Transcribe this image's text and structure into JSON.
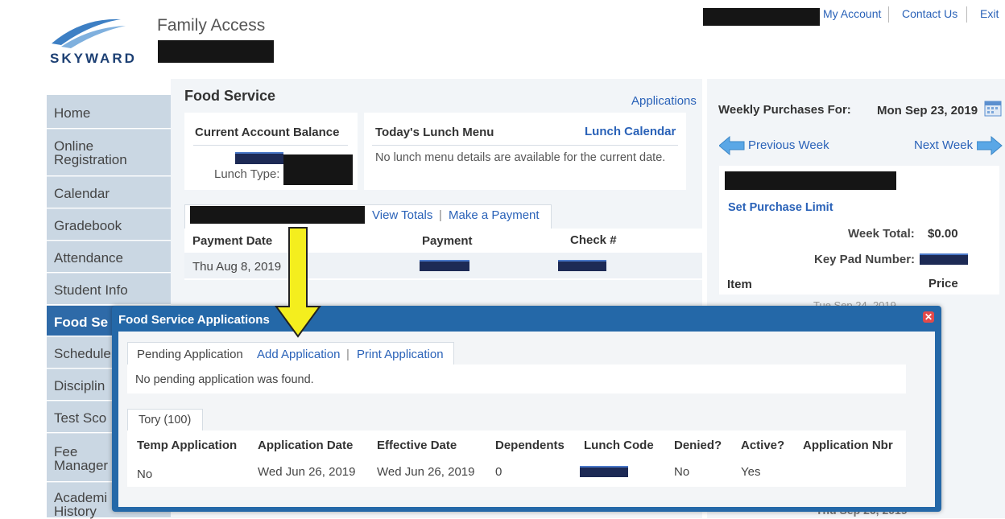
{
  "header": {
    "brand_text": "SKYWARD",
    "app_title": "Family Access",
    "links": {
      "my_account": "My Account",
      "contact_us": "Contact Us",
      "exit": "Exit"
    }
  },
  "sidebar": {
    "items": [
      {
        "label": "Home"
      },
      {
        "label": "Online Registration"
      },
      {
        "label": "Calendar"
      },
      {
        "label": "Gradebook"
      },
      {
        "label": "Attendance"
      },
      {
        "label": "Student Info"
      },
      {
        "label": "Food Se"
      },
      {
        "label": "Schedule"
      },
      {
        "label": "Disciplin"
      },
      {
        "label": "Test Sco"
      },
      {
        "label": "Fee Manager"
      },
      {
        "label": "Academi History"
      }
    ]
  },
  "food_service": {
    "title": "Food Service",
    "applications_link": "Applications",
    "balance_header": "Current Account Balance",
    "lunch_type_label": "Lunch Type:",
    "menu_header": "Today's Lunch Menu",
    "lunch_calendar_link": "Lunch Calendar",
    "menu_message": "No lunch menu details are available for the current date.",
    "view_totals": "View Totals",
    "make_payment": "Make a Payment",
    "link_sep": "|",
    "payments": {
      "columns": [
        "Payment Date",
        "Payment",
        "Check #"
      ],
      "rows": [
        {
          "date": "Thu Aug 8, 2019"
        }
      ]
    }
  },
  "weekly": {
    "label": "Weekly Purchases For:",
    "date": "Mon Sep 23, 2019",
    "previous_week": "Previous Week",
    "next_week": "Next Week",
    "set_limit": "Set Purchase Limit",
    "week_total_label": "Week Total:",
    "week_total_value": "$0.00",
    "key_pad_label": "Key Pad Number:",
    "col_item": "Item",
    "col_price": "Price",
    "bottom_date": "Thu Sep 26, 2019",
    "behind_date": "Tue Sep 24, 2019"
  },
  "modal": {
    "title": "Food Service Applications",
    "tab_pending": "Pending Application",
    "add_application": "Add Application",
    "print_application": "Print Application",
    "sep": "|",
    "pending_message": "No pending application was found.",
    "student_tab": "Tory (100)",
    "columns": [
      "Temp Application",
      "Application Date",
      "Effective Date",
      "Dependents",
      "Lunch Code",
      "Denied?",
      "Active?",
      "Application Nbr"
    ],
    "row": {
      "temp": "No",
      "app_date": "Wed Jun 26, 2019",
      "effective_date": "Wed Jun 26, 2019",
      "dependents": "0",
      "denied": "No",
      "active": "Yes"
    }
  },
  "colors": {
    "accent": "#2468a8",
    "link": "#2a62b8",
    "arrow": "#f4ee1e",
    "redaction": "#151515"
  },
  "icons": [
    "skyward-logo-icon",
    "calendar-icon",
    "arrow-left-icon",
    "arrow-right-icon",
    "close-icon",
    "annotation-arrow-icon"
  ]
}
